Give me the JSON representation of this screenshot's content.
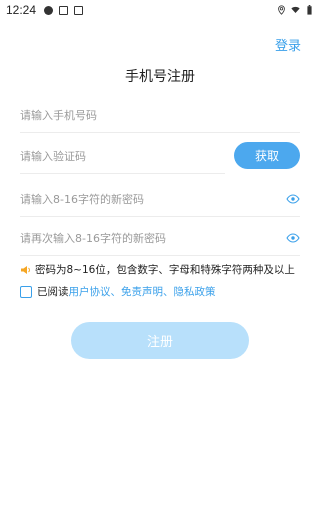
{
  "status_bar": {
    "time": "12:24"
  },
  "header": {
    "login_link": "登录",
    "title": "手机号注册"
  },
  "form": {
    "phone_placeholder": "请输入手机号码",
    "code_placeholder": "请输入验证码",
    "get_code_label": "获取",
    "password_placeholder": "请输入8-16字符的新密码",
    "confirm_password_placeholder": "请再次输入8-16字符的新密码"
  },
  "hint": {
    "text": "密码为8~16位，包含数字、字母和特殊字符两种及以上",
    "icon": "speaker-icon"
  },
  "agreement": {
    "prefix": "已阅读",
    "user_agreement": "用户协议",
    "sep1": "、",
    "disclaimer": "免责声明",
    "sep2": "、",
    "privacy_policy": "隐私政策"
  },
  "register_button": "注册",
  "colors": {
    "accent": "#3aa0ea",
    "get_code_bg": "#4ca8ee",
    "register_bg_disabled": "#b8e0fb",
    "hint_icon": "#f5a623"
  }
}
